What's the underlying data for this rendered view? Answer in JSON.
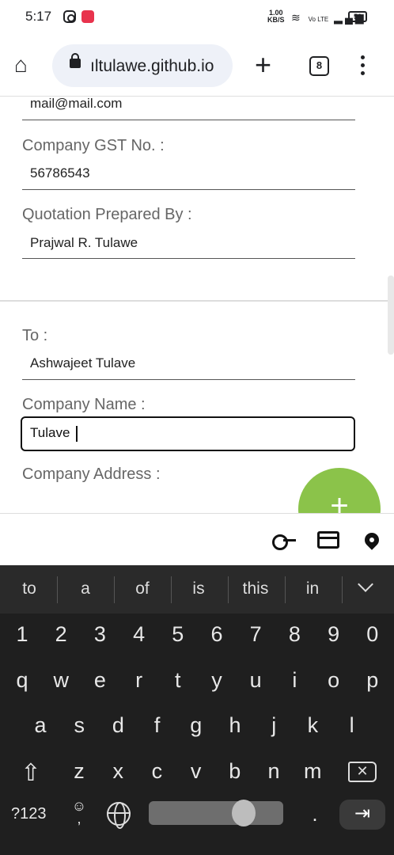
{
  "status_bar": {
    "time": "5:17",
    "speed_value": "1.00",
    "speed_unit": "KB/S",
    "network": "Vo LTE",
    "battery": "56"
  },
  "browser": {
    "url": "ıltulawe.github.io",
    "tab_count": "8"
  },
  "form": {
    "email_value": "mail@mail.com",
    "gst_label": "Company GST No. :",
    "gst_value": "56786543",
    "prepared_label": "Quotation Prepared By :",
    "prepared_value": "Prajwal R. Tulawe",
    "to_label": "To :",
    "to_value": "Ashwajeet Tulave",
    "company_name_label": "Company Name :",
    "company_name_value": "Tulave",
    "company_address_label": "Company Address :"
  },
  "fab_label": "+",
  "keyboard": {
    "suggestions": [
      "to",
      "a",
      "of",
      "is",
      "this",
      "in"
    ],
    "row_numbers": [
      "1",
      "2",
      "3",
      "4",
      "5",
      "6",
      "7",
      "8",
      "9",
      "0"
    ],
    "row1": [
      "q",
      "w",
      "e",
      "r",
      "t",
      "y",
      "u",
      "i",
      "o",
      "p"
    ],
    "row2": [
      "a",
      "s",
      "d",
      "f",
      "g",
      "h",
      "j",
      "k",
      "l"
    ],
    "row3": [
      "z",
      "x",
      "c",
      "v",
      "b",
      "n",
      "m"
    ],
    "symbols_label": "?123",
    "period_label": "."
  }
}
